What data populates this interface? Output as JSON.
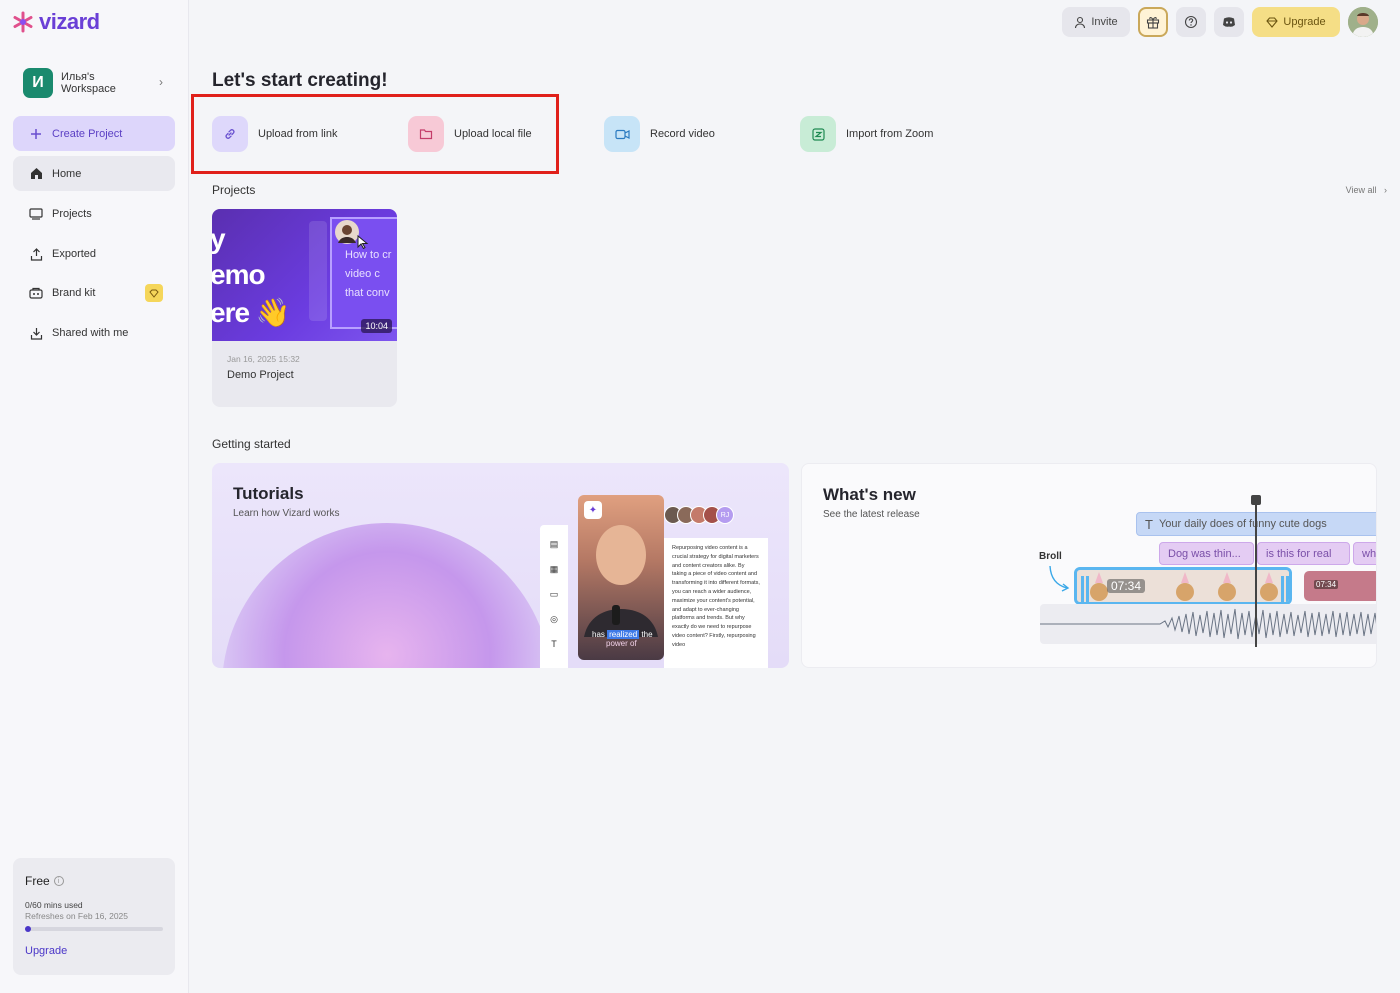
{
  "app": {
    "name": "vizard",
    "brand_color": "#6a3fd6"
  },
  "workspace": {
    "initial": "И",
    "name_line1": "Илья's",
    "name_line2": "Workspace"
  },
  "sidebar": {
    "create_project": "Create Project",
    "items": [
      {
        "label": "Home",
        "icon": "home-icon"
      },
      {
        "label": "Projects",
        "icon": "projects-icon"
      },
      {
        "label": "Exported",
        "icon": "export-icon"
      },
      {
        "label": "Brand kit",
        "icon": "brand-kit-icon"
      },
      {
        "label": "Shared with me",
        "icon": "shared-icon"
      }
    ]
  },
  "plan": {
    "name": "Free",
    "usage": "0/60 mins used",
    "refresh": "Refreshes on Feb 16, 2025",
    "usage_fraction": 0.0,
    "upgrade_label": "Upgrade"
  },
  "topbar": {
    "invite": "Invite",
    "upgrade": "Upgrade"
  },
  "main": {
    "title": "Let's start creating!",
    "quick_actions": [
      {
        "label": "Upload from link",
        "icon": "link-icon",
        "color": "#ded8fb"
      },
      {
        "label": "Upload local file",
        "icon": "folder-icon",
        "color": "#f7c9d6"
      },
      {
        "label": "Record video",
        "icon": "video-camera-icon",
        "color": "#c7e4f7"
      },
      {
        "label": "Import from Zoom",
        "icon": "zoom-icon",
        "color": "#c8ecd6"
      }
    ],
    "projects_label": "Projects",
    "view_all": "View all",
    "projects": [
      {
        "thumb_lines": [
          "y",
          "emo",
          "ere 👋"
        ],
        "thumb_captions": [
          "How to cr",
          "video c",
          "that conv"
        ],
        "duration": "10:04",
        "date": "Jan 16, 2025 15:32",
        "name": "Demo Project"
      }
    ],
    "getting_started_label": "Getting started"
  },
  "tutorials": {
    "title": "Tutorials",
    "subtitle": "Learn how Vizard works",
    "caption_pre": "has",
    "caption_highlight": "realized",
    "caption_post": "the",
    "caption_line2": "power of",
    "text_excerpt": "Repurposing video content is a crucial strategy for digital marketers and content creators alike. By taking a piece of video content and transforming it into different formats, you can reach a wider audience, maximize your content's potential, and adapt to ever-changing platforms and trends. But why exactly do we need to repurpose video content? Firstly, repurposing video",
    "avatar_initials": "RJ"
  },
  "whats_new": {
    "title": "What's new",
    "subtitle": "See the latest release",
    "text_bar": "Your daily does of funny cute dogs",
    "pills": [
      "Dog was thin...",
      "is this for real",
      "wh"
    ],
    "broll_label": "Broll",
    "clip_time": "07:34",
    "clip2_time": "07:34"
  }
}
